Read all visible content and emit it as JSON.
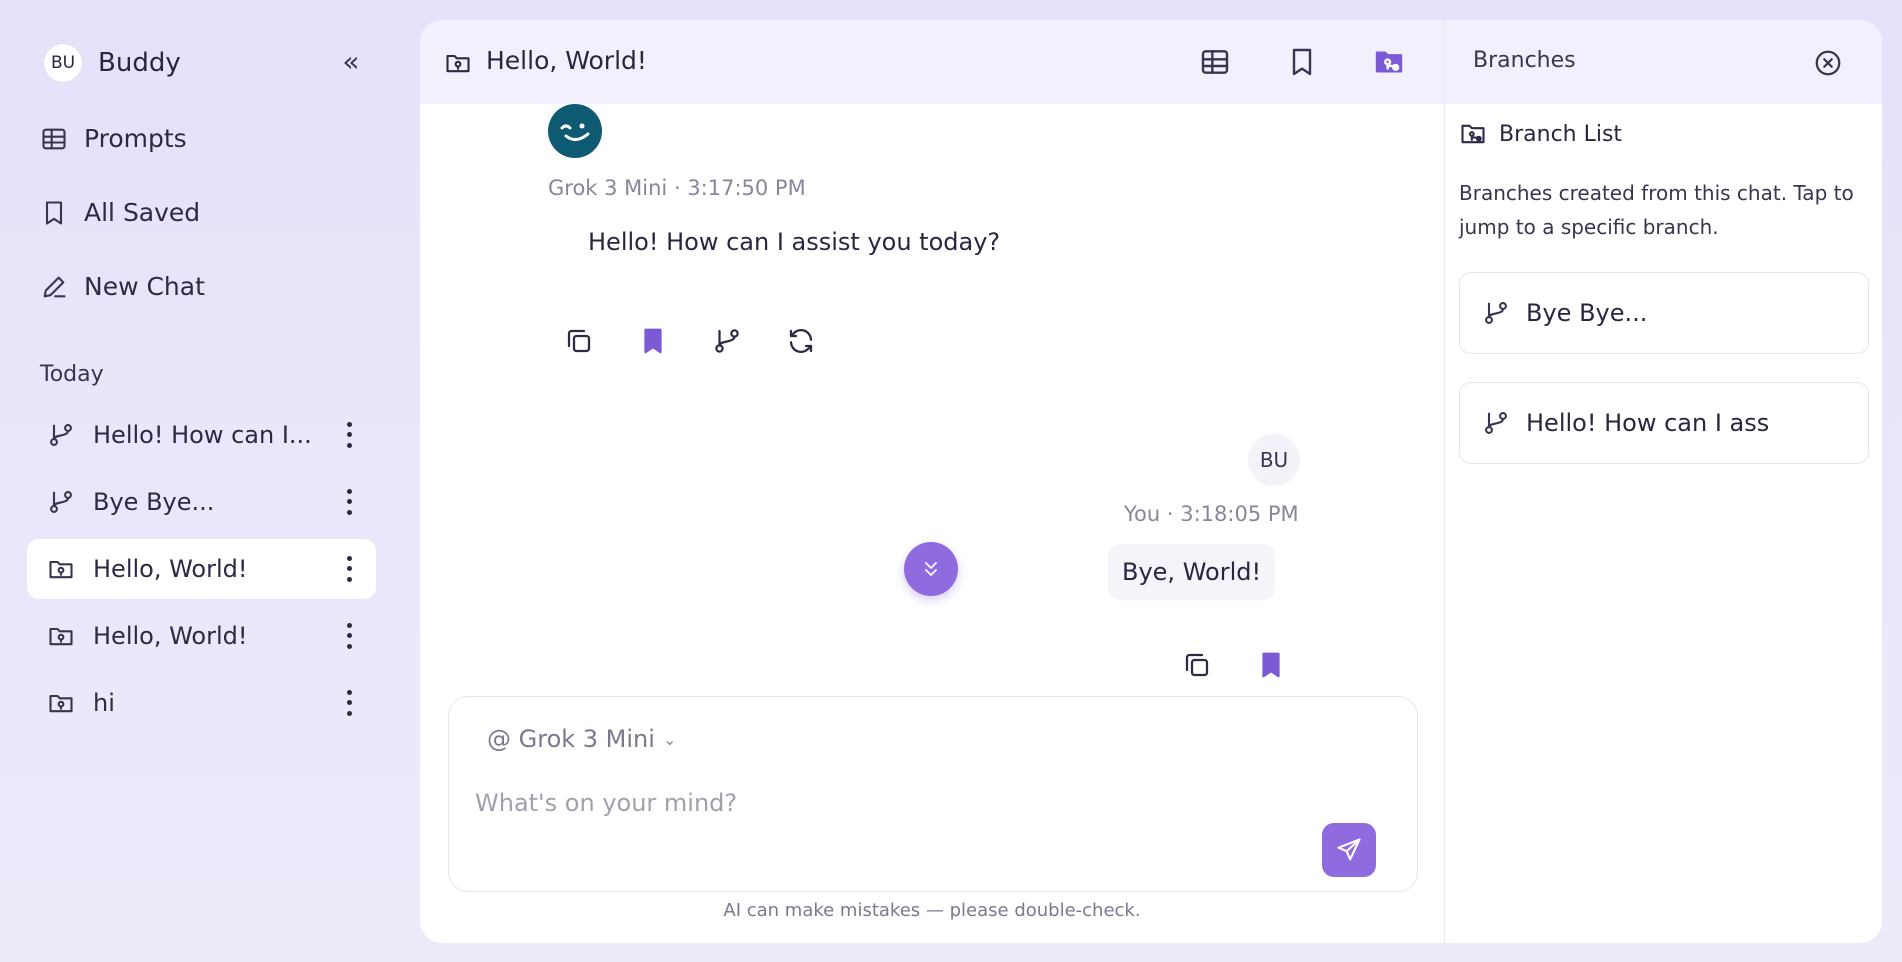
{
  "sidebar": {
    "user_initials": "BU",
    "user_name": "Buddy",
    "collapse_glyph": "«",
    "nav": [
      {
        "label": "Prompts",
        "icon": "table-icon"
      },
      {
        "label": "All Saved",
        "icon": "bookmark-icon"
      },
      {
        "label": "New Chat",
        "icon": "pencil-icon"
      }
    ],
    "section_label": "Today",
    "chats": [
      {
        "label": "Hello! How can I...",
        "icon": "branch-icon",
        "active": false
      },
      {
        "label": "Bye Bye...",
        "icon": "branch-icon",
        "active": false
      },
      {
        "label": "Hello, World!",
        "icon": "folder-icon",
        "active": true
      },
      {
        "label": "Hello, World!",
        "icon": "folder-icon",
        "active": false
      },
      {
        "label": "hi",
        "icon": "folder-icon",
        "active": false
      }
    ]
  },
  "header": {
    "title": "Hello, World!"
  },
  "messages": {
    "bot": {
      "meta": "Grok 3 Mini · 3:17:50 PM",
      "text": "Hello! How can I assist you today?"
    },
    "user": {
      "initials": "BU",
      "meta": "You · 3:18:05 PM",
      "text": "Bye, World!"
    }
  },
  "composer": {
    "model": "@ Grok 3 Mini",
    "placeholder": "What's on your mind?",
    "disclaimer": "AI can make mistakes — please double-check."
  },
  "branches": {
    "title": "Branches",
    "list_title": "Branch List",
    "description": "Branches created from this chat. Tap to jump to a specific branch.",
    "items": [
      "Bye Bye...",
      "Hello! How can I ass"
    ]
  },
  "colors": {
    "accent": "#8f6bdf",
    "sidebar_bg": "#e6e1fa",
    "header_bg": "#f3f0fd"
  }
}
